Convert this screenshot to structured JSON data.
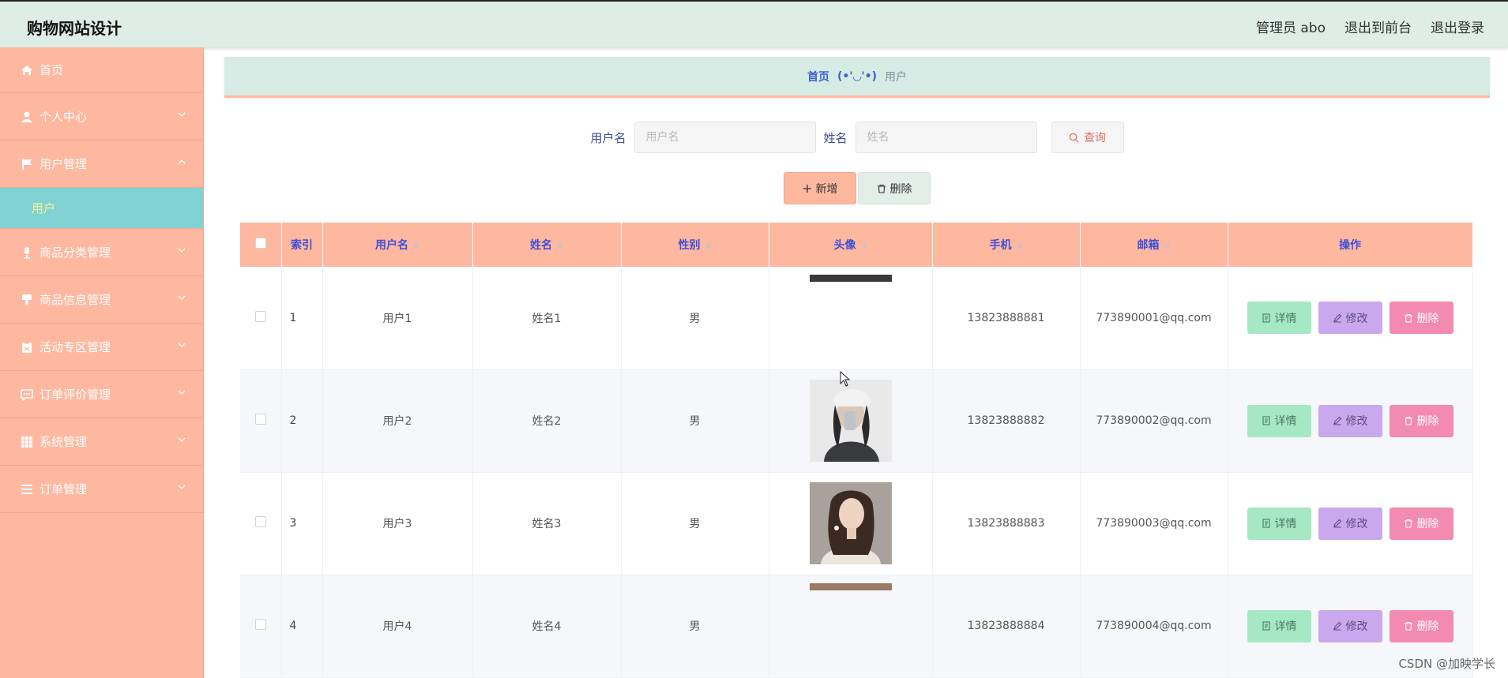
{
  "header": {
    "brand": "购物网站设计",
    "admin": "管理员 abo",
    "to_front": "退出到前台",
    "logout": "退出登录"
  },
  "sidebar": {
    "items": [
      {
        "label": "首页",
        "icon": "home-icon"
      },
      {
        "label": "个人中心",
        "icon": "user-icon"
      },
      {
        "label": "用户管理",
        "icon": "flag-icon",
        "expanded": true,
        "children": [
          {
            "label": "用户"
          }
        ]
      },
      {
        "label": "商品分类管理",
        "icon": "mic-icon"
      },
      {
        "label": "商品信息管理",
        "icon": "brush-icon"
      },
      {
        "label": "活动专区管理",
        "icon": "clipboard-icon"
      },
      {
        "label": "订单评价管理",
        "icon": "chat-icon"
      },
      {
        "label": "系统管理",
        "icon": "grid-icon"
      },
      {
        "label": "订单管理",
        "icon": "list-icon"
      }
    ]
  },
  "breadcrumb": {
    "home": "首页",
    "separator": "(•'◡'•)",
    "current": "用户"
  },
  "search": {
    "username_label": "用户名",
    "username_placeholder": "用户名",
    "name_label": "姓名",
    "name_placeholder": "姓名",
    "query_label": "查询"
  },
  "actions": {
    "add_label": "新增",
    "delete_label": "删除"
  },
  "table": {
    "columns": [
      "索引",
      "用户名",
      "姓名",
      "性别",
      "头像",
      "手机",
      "邮箱",
      "操作"
    ],
    "rows": [
      {
        "index": "1",
        "username": "用户1",
        "name": "姓名1",
        "gender": "男",
        "phone": "13823888881",
        "email": "773890001@qq.com"
      },
      {
        "index": "2",
        "username": "用户2",
        "name": "姓名2",
        "gender": "男",
        "phone": "13823888882",
        "email": "773890002@qq.com"
      },
      {
        "index": "3",
        "username": "用户3",
        "name": "姓名3",
        "gender": "男",
        "phone": "13823888883",
        "email": "773890003@qq.com"
      },
      {
        "index": "4",
        "username": "用户4",
        "name": "姓名4",
        "gender": "男",
        "phone": "13823888884",
        "email": "773890004@qq.com"
      }
    ],
    "op_detail": "详情",
    "op_edit": "修改",
    "op_delete": "删除"
  },
  "watermark": "CSDN @加映学长",
  "colors": {
    "sidebar": "#ffb8a0",
    "submenu_active": "#80d2d2",
    "header": "#deede6",
    "detail": "#a6e8c4",
    "edit": "#c9a8ee",
    "delete": "#f38ab0"
  }
}
